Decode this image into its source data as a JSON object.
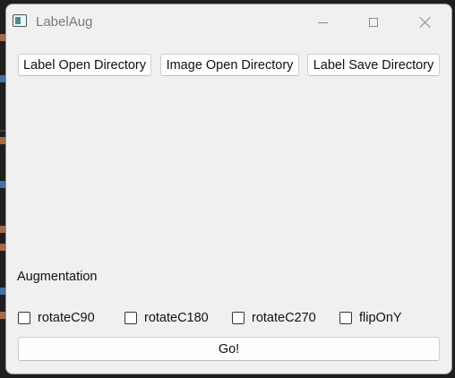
{
  "window": {
    "title": "LabelAug",
    "controls": [
      "minimize",
      "maximize",
      "close"
    ]
  },
  "buttons": {
    "label_open": "Label Open Directory",
    "image_open": "Image Open Directory",
    "label_save": "Label Save Directory",
    "go": "Go!"
  },
  "augmentation": {
    "heading": "Augmentation",
    "options": [
      {
        "label": "rotateC90",
        "checked": false
      },
      {
        "label": "rotateC180",
        "checked": false
      },
      {
        "label": "rotateC270",
        "checked": false
      },
      {
        "label": "flipOnY",
        "checked": false
      }
    ]
  },
  "icons": {
    "app": "app-window-icon",
    "minimize": "minimize-icon",
    "maximize": "maximize-icon",
    "close": "close-icon"
  }
}
